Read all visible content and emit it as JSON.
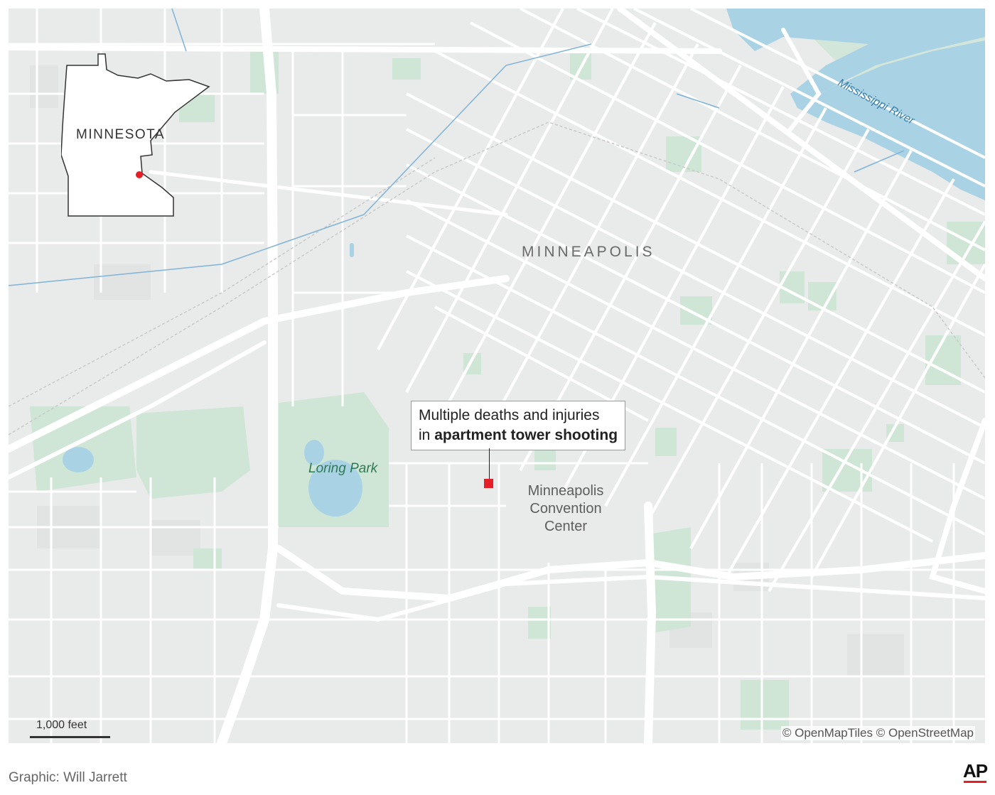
{
  "colors": {
    "land": "#e9eaea",
    "road": "#ffffff",
    "park": "#cfe6d7",
    "water": "#a9d3e4",
    "marker": "#e61e26",
    "text": "#5b5b5b"
  },
  "map": {
    "city_label": "MINNEAPOLIS",
    "park_label": "Loring Park",
    "river_label": "Mississippi River",
    "convention_center": [
      "Minneapolis",
      "Convention",
      "Center"
    ],
    "scale_label": "1,000 feet",
    "attribution": "© OpenMapTiles © OpenStreetMap"
  },
  "callout": {
    "line1": "Multiple deaths and injuries",
    "line2_prefix": "in ",
    "line2_bold": "apartment tower shooting"
  },
  "inset": {
    "state_label": "MINNESOTA"
  },
  "footer": {
    "credit": "Graphic: Will Jarrett",
    "logo": "AP"
  }
}
